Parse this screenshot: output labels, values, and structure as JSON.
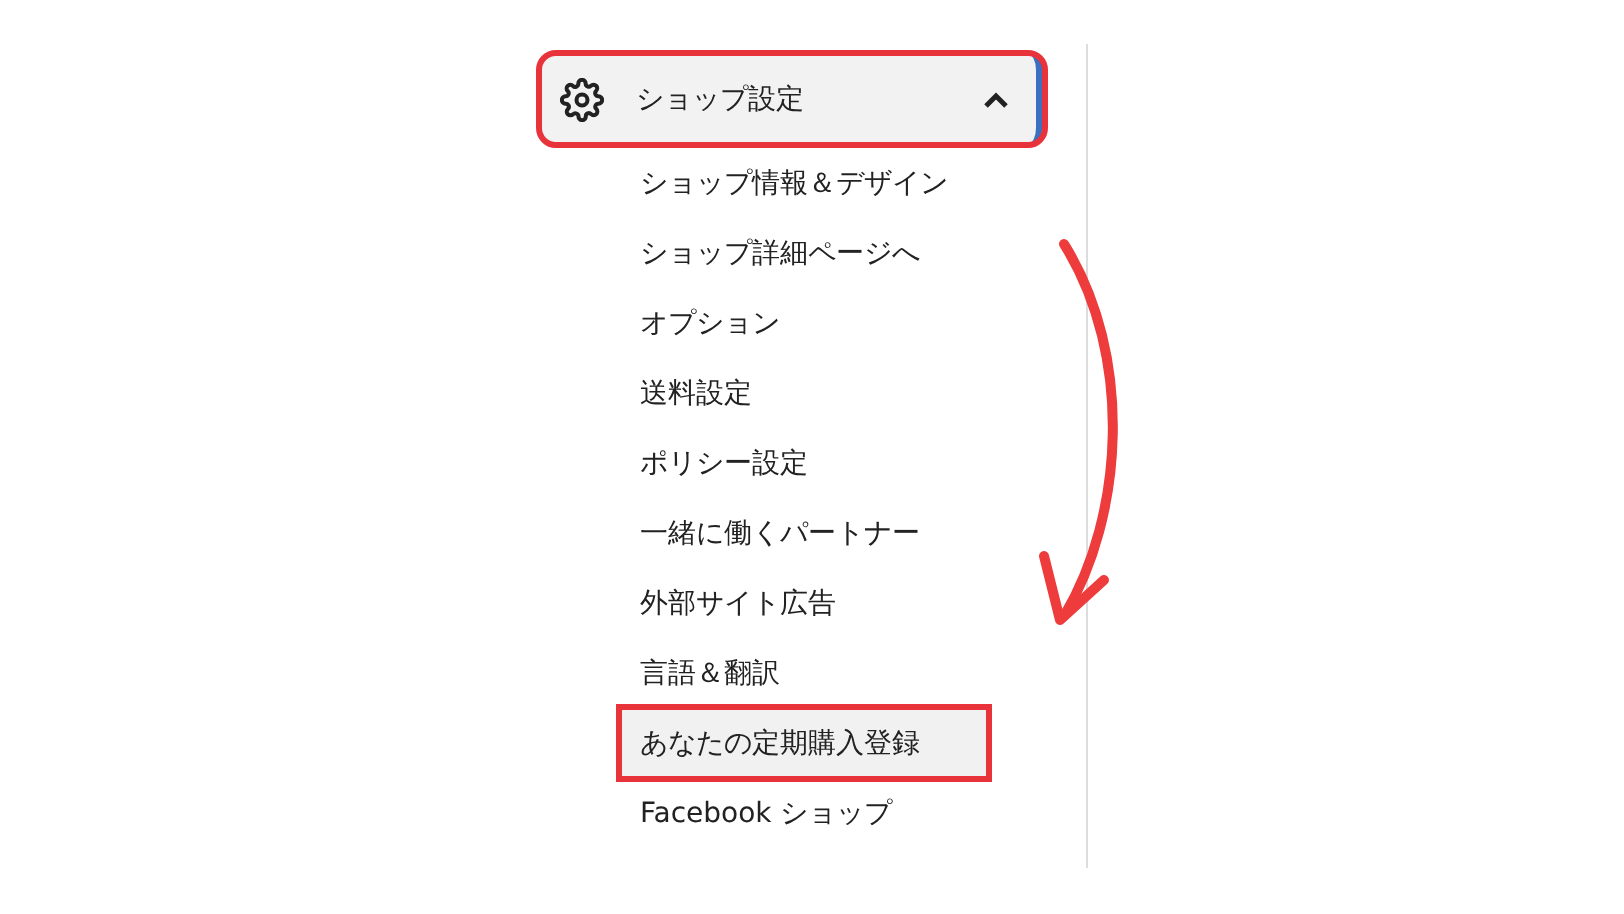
{
  "menu": {
    "header": {
      "label": "ショップ設定",
      "expanded": true,
      "annotated": true
    },
    "items": [
      {
        "label": "ショップ情報＆デザイン",
        "selected": false,
        "annotated": false
      },
      {
        "label": "ショップ詳細ページへ",
        "selected": false,
        "annotated": false
      },
      {
        "label": "オプション",
        "selected": false,
        "annotated": false
      },
      {
        "label": "送料設定",
        "selected": false,
        "annotated": false
      },
      {
        "label": "ポリシー設定",
        "selected": false,
        "annotated": false
      },
      {
        "label": "一緒に働くパートナー",
        "selected": false,
        "annotated": false
      },
      {
        "label": "外部サイト広告",
        "selected": false,
        "annotated": false
      },
      {
        "label": "言語＆翻訳",
        "selected": false,
        "annotated": false
      },
      {
        "label": "あなたの定期購入登録",
        "selected": true,
        "annotated": true
      },
      {
        "label": "Facebook ショップ",
        "selected": false,
        "annotated": false
      }
    ]
  }
}
